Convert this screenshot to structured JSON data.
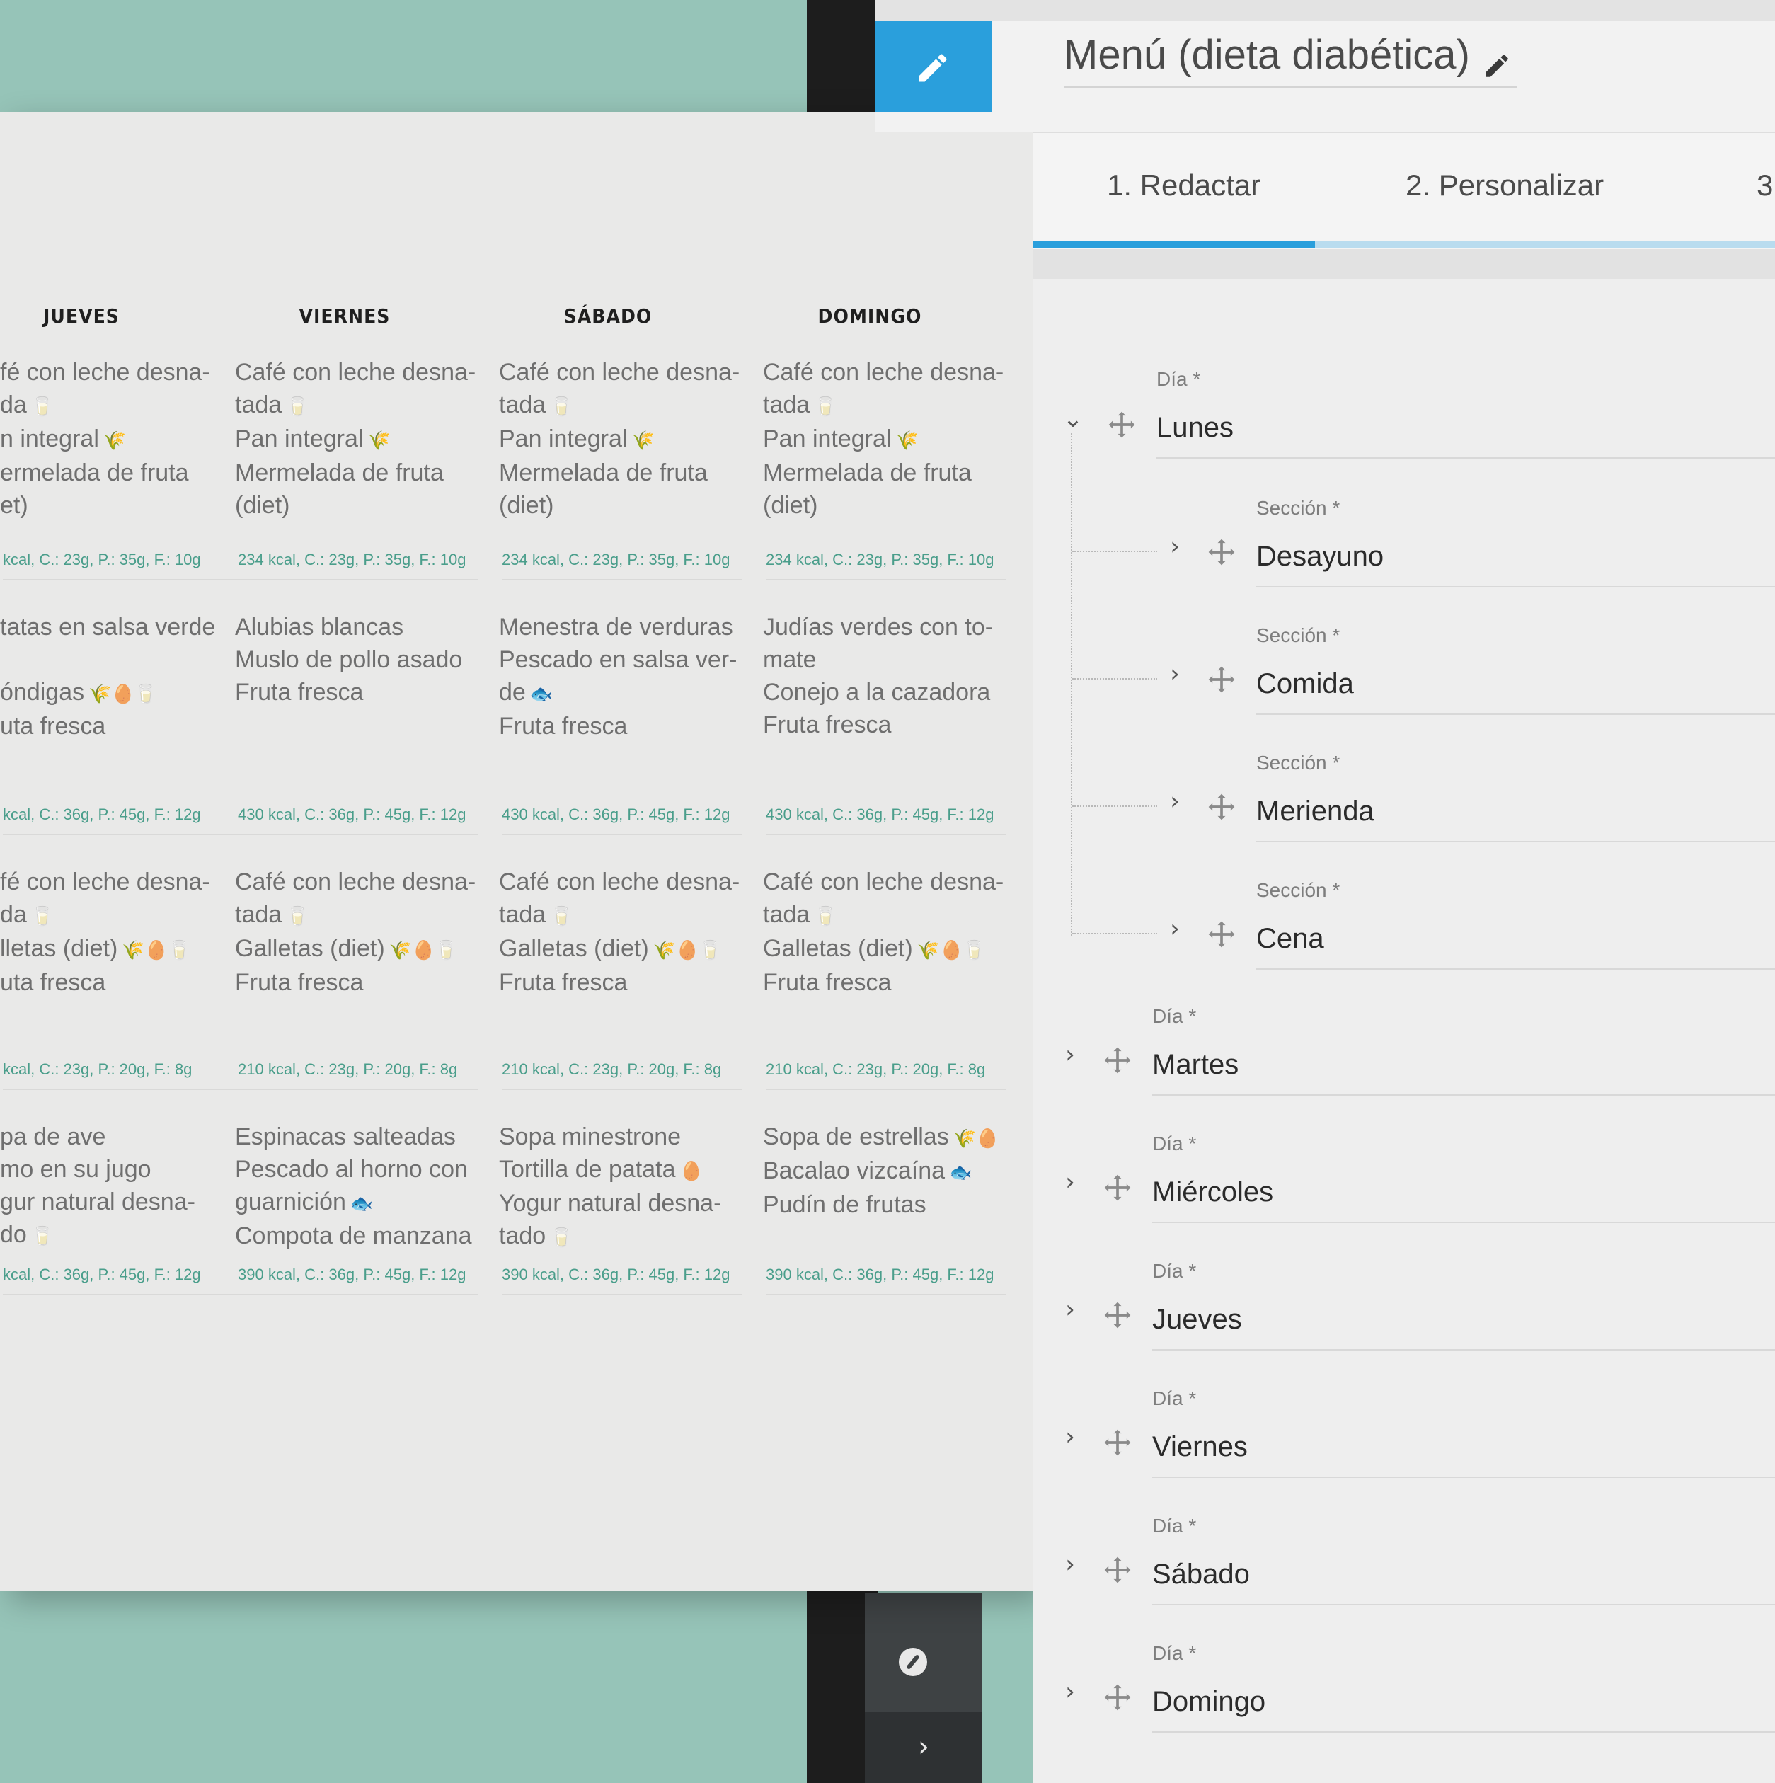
{
  "paper": {
    "columns": [
      {
        "day": "JUEVES",
        "meals": [
          {
            "lines": [
              {
                "t": "fé con leche desna-"
              },
              {
                "t": "da",
                "i": "🥛"
              },
              {
                "t": "n integral",
                "i": "🌾"
              },
              {
                "t": "ermelada de fruta"
              },
              {
                "t": "et)"
              }
            ],
            "kcal": "kcal, C.: 23g, P.: 35g, F.: 10g"
          },
          {
            "lines": [
              {
                "t": "tatas en salsa verde"
              },
              {
                "t": ""
              },
              {
                "t": "óndigas",
                "i": "🌾🥚🥛"
              },
              {
                "t": "uta fresca"
              }
            ],
            "kcal": "kcal, C.: 36g, P.: 45g, F.: 12g"
          },
          {
            "lines": [
              {
                "t": "fé con leche desna-"
              },
              {
                "t": "da",
                "i": "🥛"
              },
              {
                "t": "lletas (diet)",
                "i": "🌾🥚🥛"
              },
              {
                "t": "uta fresca"
              }
            ],
            "kcal": "kcal, C.: 23g, P.: 20g, F.: 8g"
          },
          {
            "lines": [
              {
                "t": "pa de ave"
              },
              {
                "t": "mo en su jugo"
              },
              {
                "t": "gur natural desna-"
              },
              {
                "t": "do",
                "i": "🥛"
              }
            ],
            "kcal": "kcal, C.: 36g, P.: 45g, F.: 12g"
          }
        ]
      },
      {
        "day": "VIERNES",
        "meals": [
          {
            "lines": [
              {
                "t": "Café con leche desna-"
              },
              {
                "t": "tada",
                "i": "🥛"
              },
              {
                "t": "Pan integral",
                "i": "🌾"
              },
              {
                "t": "Mermelada de fruta"
              },
              {
                "t": "(diet)"
              }
            ],
            "kcal": "234 kcal, C.: 23g, P.: 35g, F.: 10g"
          },
          {
            "lines": [
              {
                "t": "Alubias blancas"
              },
              {
                "t": "Muslo de pollo asado"
              },
              {
                "t": "Fruta fresca"
              }
            ],
            "kcal": "430 kcal, C.: 36g, P.: 45g, F.: 12g"
          },
          {
            "lines": [
              {
                "t": "Café con leche desna-"
              },
              {
                "t": "tada",
                "i": "🥛"
              },
              {
                "t": "Galletas (diet)",
                "i": "🌾🥚🥛"
              },
              {
                "t": "Fruta fresca"
              }
            ],
            "kcal": "210 kcal, C.: 23g, P.: 20g, F.: 8g"
          },
          {
            "lines": [
              {
                "t": "Espinacas salteadas"
              },
              {
                "t": "Pescado al horno con"
              },
              {
                "t": "guarnición",
                "i": "🐟"
              },
              {
                "t": "Compota de manzana"
              }
            ],
            "kcal": "390 kcal, C.: 36g, P.: 45g, F.: 12g"
          }
        ]
      },
      {
        "day": "SÁBADO",
        "meals": [
          {
            "lines": [
              {
                "t": "Café con leche desna-"
              },
              {
                "t": "tada",
                "i": "🥛"
              },
              {
                "t": "Pan integral",
                "i": "🌾"
              },
              {
                "t": "Mermelada de fruta"
              },
              {
                "t": "(diet)"
              }
            ],
            "kcal": "234 kcal, C.: 23g, P.: 35g, F.: 10g"
          },
          {
            "lines": [
              {
                "t": "Menestra de verduras"
              },
              {
                "t": "Pescado en salsa ver-"
              },
              {
                "t": "de",
                "i": "🐟"
              },
              {
                "t": "Fruta fresca"
              }
            ],
            "kcal": "430 kcal, C.: 36g, P.: 45g, F.: 12g"
          },
          {
            "lines": [
              {
                "t": "Café con leche desna-"
              },
              {
                "t": "tada",
                "i": "🥛"
              },
              {
                "t": "Galletas (diet)",
                "i": "🌾🥚🥛"
              },
              {
                "t": "Fruta fresca"
              }
            ],
            "kcal": "210 kcal, C.: 23g, P.: 20g, F.: 8g"
          },
          {
            "lines": [
              {
                "t": "Sopa minestrone"
              },
              {
                "t": "Tortilla de patata",
                "i": "🥚"
              },
              {
                "t": "Yogur natural desna-"
              },
              {
                "t": "tado",
                "i": "🥛"
              }
            ],
            "kcal": "390 kcal, C.: 36g, P.: 45g, F.: 12g"
          }
        ]
      },
      {
        "day": "DOMINGO",
        "meals": [
          {
            "lines": [
              {
                "t": "Café con leche desna-"
              },
              {
                "t": "tada",
                "i": "🥛"
              },
              {
                "t": "Pan integral",
                "i": "🌾"
              },
              {
                "t": "Mermelada de fruta"
              },
              {
                "t": "(diet)"
              }
            ],
            "kcal": "234 kcal, C.: 23g, P.: 35g, F.: 10g"
          },
          {
            "lines": [
              {
                "t": "Judías verdes con to-"
              },
              {
                "t": "mate"
              },
              {
                "t": "Conejo a la cazadora"
              },
              {
                "t": "Fruta fresca"
              }
            ],
            "kcal": "430 kcal, C.: 36g, P.: 45g, F.: 12g"
          },
          {
            "lines": [
              {
                "t": "Café con leche desna-"
              },
              {
                "t": "tada",
                "i": "🥛"
              },
              {
                "t": "Galletas (diet)",
                "i": "🌾🥚🥛"
              },
              {
                "t": "Fruta fresca"
              }
            ],
            "kcal": "210 kcal, C.: 23g, P.: 20g, F.: 8g"
          },
          {
            "lines": [
              {
                "t": "Sopa de estrellas",
                "i": "🌾🥚"
              },
              {
                "t": "Bacalao vizcaína",
                "i": "🐟"
              },
              {
                "t": "Pudín de frutas"
              }
            ],
            "kcal": "390 kcal, C.: 36g, P.: 45g, F.: 12g"
          }
        ]
      }
    ]
  },
  "editor": {
    "title": "Menú (dieta diabética)",
    "tabs": [
      "1. Redactar",
      "2. Personalizar",
      "3."
    ],
    "progress_fraction": 0.38,
    "accent": "#2a9fdc",
    "day_label": "Día *",
    "section_label": "Sección *",
    "expanded_day": "Lunes",
    "sections": [
      "Desayuno",
      "Comida",
      "Merienda",
      "Cena"
    ],
    "collapsed_days": [
      "Martes",
      "Miércoles",
      "Jueves",
      "Viernes",
      "Sábado",
      "Domingo"
    ]
  },
  "icons": {
    "edit": "pencil-icon",
    "drag": "move-arrows-icon",
    "expand": "chevron-right-icon",
    "collapse": "chevron-down-icon",
    "rail": "compass-icon"
  }
}
